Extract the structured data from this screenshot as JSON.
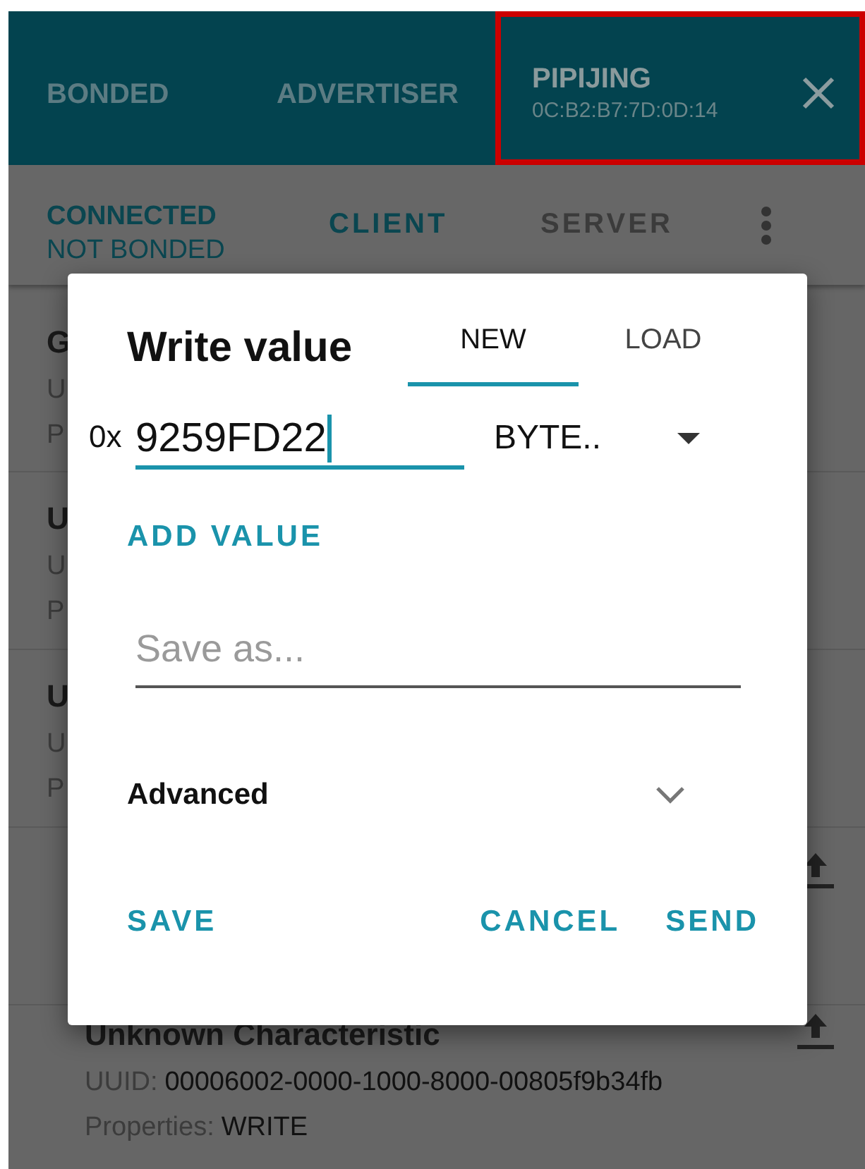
{
  "tabs": [
    {
      "label": "BONDED",
      "selected": false
    },
    {
      "label": "ADVERTISER",
      "selected": false
    },
    {
      "label": "PIPIJING",
      "subtitle": "0C:B2:B7:7D:0D:14",
      "selected": true,
      "highlighted": true
    }
  ],
  "connection": {
    "state": "CONNECTED",
    "bond": "NOT BONDED"
  },
  "subtabs": [
    {
      "label": "CLIENT",
      "selected": true
    },
    {
      "label": "SERVER",
      "selected": false
    }
  ],
  "list": [
    {
      "title": "G",
      "lines": [
        {
          "label": "U"
        },
        {
          "label": "P"
        }
      ],
      "writable": false
    },
    {
      "title": "U",
      "lines": [
        {
          "label": "U"
        },
        {
          "label": "P"
        }
      ],
      "writable": false
    },
    {
      "title": "U",
      "lines": [
        {
          "label": "U"
        },
        {
          "label": "P"
        }
      ],
      "writable": false
    },
    {
      "writable": true
    },
    {
      "title": "Unknown Characteristic",
      "lines": [
        {
          "label": "UUID:",
          "value": "00006002-0000-1000-8000-00805f9b34fb"
        },
        {
          "label": "Properties:",
          "value": "WRITE"
        }
      ],
      "writable": true
    }
  ],
  "dialog": {
    "title": "Write value",
    "tabs": [
      {
        "label": "NEW",
        "selected": true
      },
      {
        "label": "LOAD",
        "selected": false
      }
    ],
    "prefix": "0x",
    "value": "9259FD22",
    "type": "BYTE..",
    "add_value": "ADD VALUE",
    "save_as": {
      "placeholder": "Save as..."
    },
    "advanced": {
      "label": "Advanced",
      "expanded": false
    },
    "buttons": [
      {
        "label": "SAVE",
        "kind": "left"
      },
      {
        "label": "CANCEL",
        "kind": "right"
      },
      {
        "label": "SEND",
        "kind": "right"
      }
    ]
  }
}
